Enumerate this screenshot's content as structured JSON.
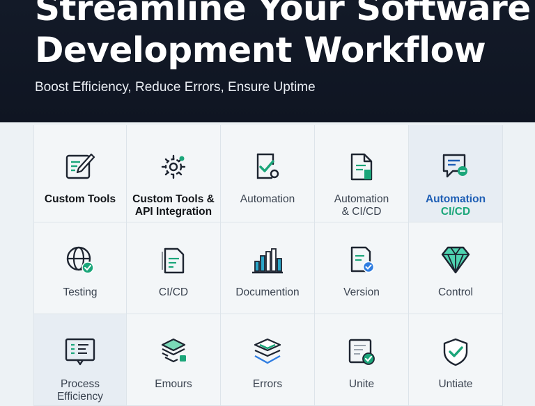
{
  "hero": {
    "title_line1": "Streamline Your Software",
    "title_line2": "Development Workflow",
    "subtitle": "Boost Efficiency, Reduce Errors, Ensure Uptime"
  },
  "tiles": [
    {
      "label": "Custom Tools",
      "icon": "pencil-document-icon"
    },
    {
      "label_line1": "Custom Tools &",
      "label_line2": "API Integration",
      "icon": "gear-settings-icon"
    },
    {
      "label": "Automation",
      "icon": "check-window-icon"
    },
    {
      "label_line1": "Automation",
      "label_line2": "& CI/CD",
      "icon": "document-icon"
    },
    {
      "label_line1": "Automation",
      "label_line2": "CI/CD",
      "icon": "chat-message-icon"
    },
    {
      "label": "Testing",
      "icon": "globe-check-icon"
    },
    {
      "label": "CI/CD",
      "icon": "file-lines-icon"
    },
    {
      "label": "Documention",
      "icon": "bar-chart-icon"
    },
    {
      "label": "Version",
      "icon": "document-badge-icon"
    },
    {
      "label": "Control",
      "icon": "diamond-icon"
    },
    {
      "label_line1": "Process",
      "label_line2": "Efficiency",
      "icon": "presentation-board-icon"
    },
    {
      "label": "Emours",
      "icon": "layers-stack-icon"
    },
    {
      "label": "Errors",
      "icon": "stacked-boxes-icon"
    },
    {
      "label": "Unite",
      "icon": "certificate-check-icon"
    },
    {
      "label": "Untiate",
      "icon": "shield-check-icon"
    }
  ],
  "colors": {
    "hero_bg": "#121927",
    "accent_green": "#1ba67a",
    "accent_blue": "#1f5fb5",
    "icon_stroke": "#1d2430"
  }
}
